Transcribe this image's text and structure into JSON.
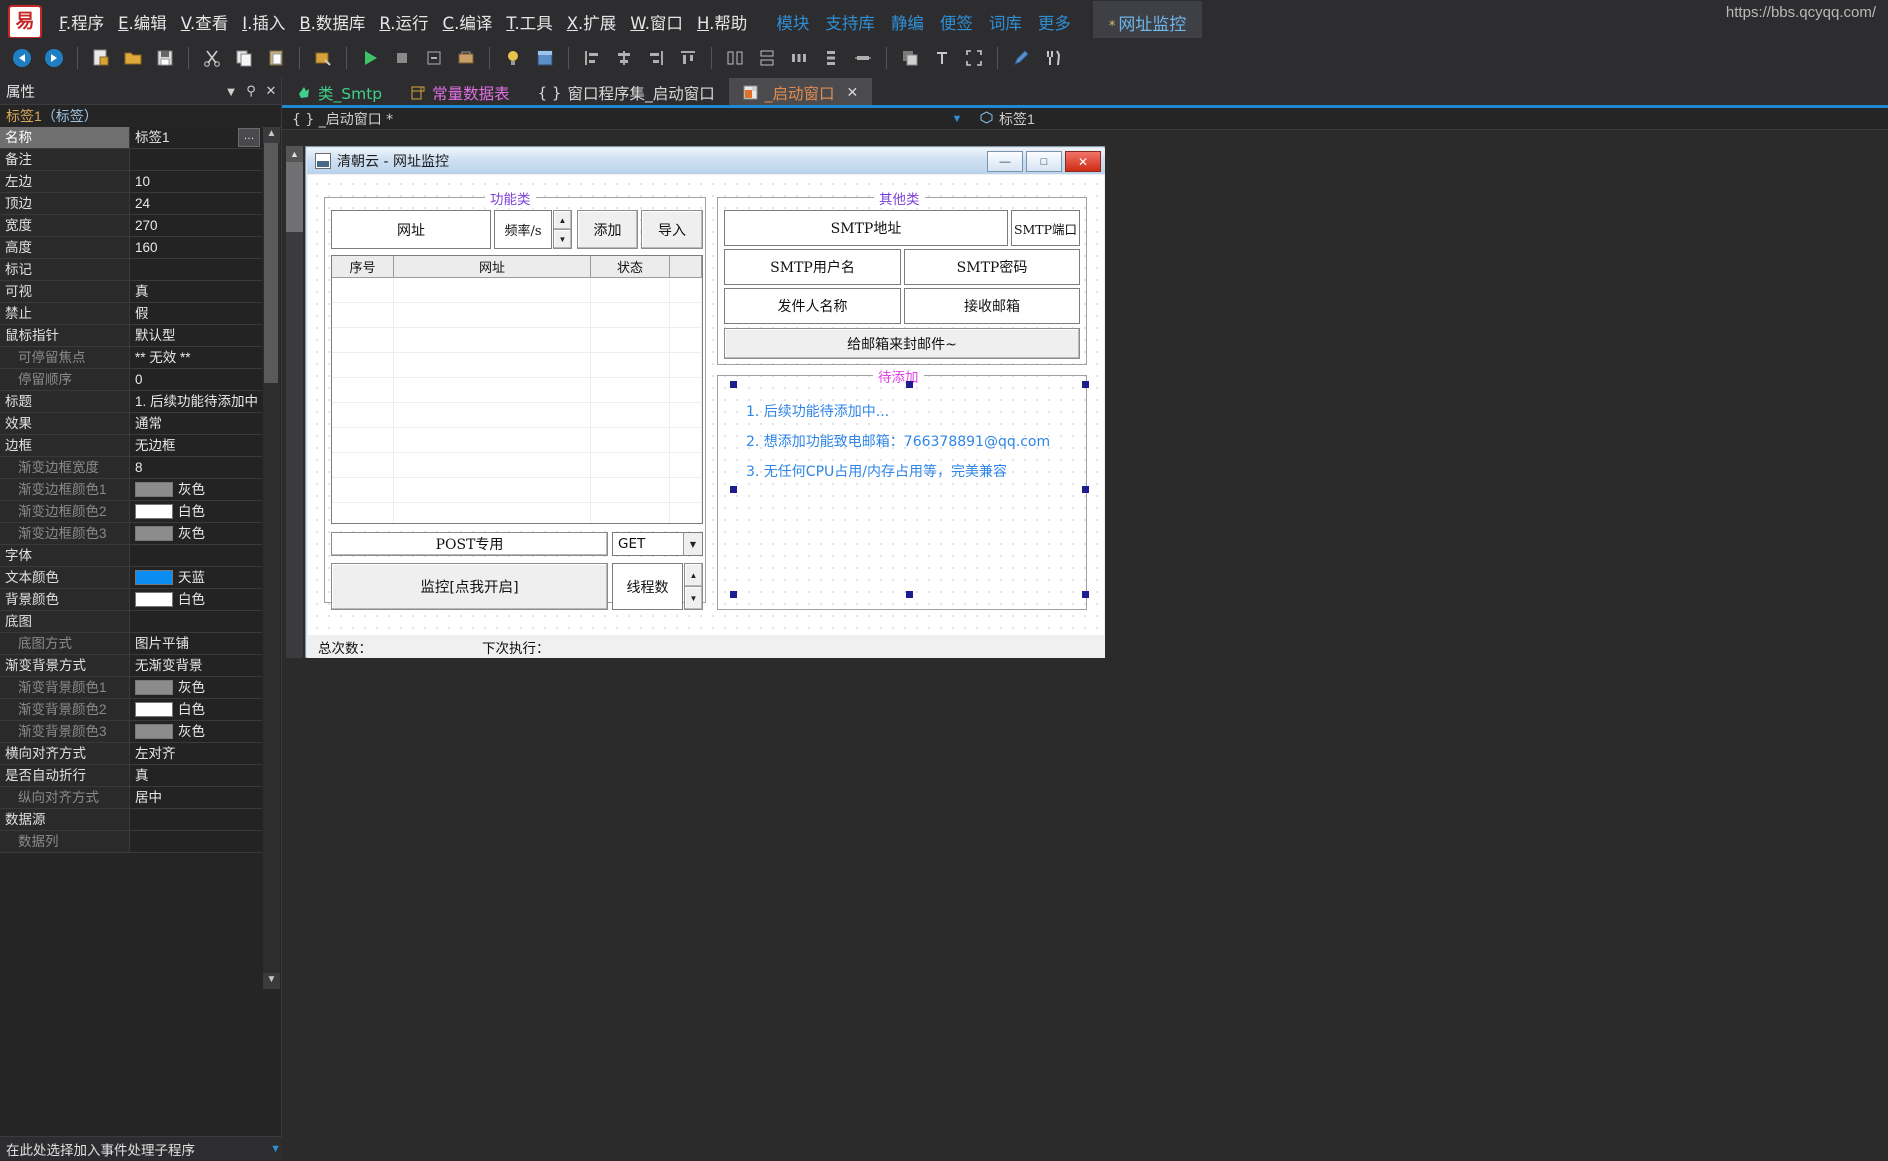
{
  "app": {
    "logo_char": "易",
    "url_right": "https://bbs.qcyqq.com/"
  },
  "menubar": {
    "items": [
      {
        "hotkey": "F",
        "label": ".程序"
      },
      {
        "hotkey": "E",
        "label": ".编辑"
      },
      {
        "hotkey": "V",
        "label": ".查看"
      },
      {
        "hotkey": "I",
        "label": ".插入"
      },
      {
        "hotkey": "B",
        "label": ".数据库"
      },
      {
        "hotkey": "R",
        "label": ".运行"
      },
      {
        "hotkey": "C",
        "label": ".编译"
      },
      {
        "hotkey": "T",
        "label": ".工具"
      },
      {
        "hotkey": "X",
        "label": ".扩展"
      },
      {
        "hotkey": "W",
        "label": ".窗口"
      },
      {
        "hotkey": "H",
        "label": ".帮助"
      }
    ],
    "blue_items": [
      "模块",
      "支持库",
      "静编",
      "便签",
      "词库",
      "更多"
    ],
    "project_tab": {
      "star": "*",
      "label": "网址监控"
    }
  },
  "properties_panel": {
    "title": "属性",
    "object": "标签1（标签）",
    "object_name": "标签1",
    "object_type": "（标签）",
    "footer": "在此处选择加入事件处理子程序",
    "rows": [
      {
        "key": "名称",
        "value": "标签1",
        "dim": false,
        "selected": true,
        "ellipsis": true
      },
      {
        "key": "备注",
        "value": "",
        "dim": false
      },
      {
        "key": "左边",
        "value": "10",
        "dim": false
      },
      {
        "key": "顶边",
        "value": "24",
        "dim": false
      },
      {
        "key": "宽度",
        "value": "270",
        "dim": false
      },
      {
        "key": "高度",
        "value": "160",
        "dim": false
      },
      {
        "key": "标记",
        "value": "",
        "dim": false
      },
      {
        "key": "可视",
        "value": "真",
        "dim": false
      },
      {
        "key": "禁止",
        "value": "假",
        "dim": false
      },
      {
        "key": "鼠标指针",
        "value": "默认型",
        "dim": false
      },
      {
        "key": "可停留焦点",
        "value": "**  无效  **",
        "dim": true
      },
      {
        "key": "停留顺序",
        "value": "0",
        "dim": true
      },
      {
        "key": "标题",
        "value": "1. 后续功能待添加中",
        "dim": false
      },
      {
        "key": "效果",
        "value": "通常",
        "dim": false
      },
      {
        "key": "边框",
        "value": "无边框",
        "dim": false
      },
      {
        "key": "渐变边框宽度",
        "value": "8",
        "dim": true
      },
      {
        "key": "渐变边框颜色1",
        "value": "灰色",
        "dim": true,
        "swatch": "#8c8c8c"
      },
      {
        "key": "渐变边框颜色2",
        "value": "白色",
        "dim": true,
        "swatch": "#ffffff"
      },
      {
        "key": "渐变边框颜色3",
        "value": "灰色",
        "dim": true,
        "swatch": "#8c8c8c"
      },
      {
        "key": "字体",
        "value": "",
        "dim": false
      },
      {
        "key": "文本颜色",
        "value": "天蓝",
        "dim": false,
        "swatch": "#0a8cf0"
      },
      {
        "key": "背景颜色",
        "value": "白色",
        "dim": false,
        "swatch": "#ffffff"
      },
      {
        "key": "底图",
        "value": "",
        "dim": false
      },
      {
        "key": "底图方式",
        "value": "图片平铺",
        "dim": true
      },
      {
        "key": "渐变背景方式",
        "value": "无渐变背景",
        "dim": false
      },
      {
        "key": "渐变背景颜色1",
        "value": "灰色",
        "dim": true,
        "swatch": "#8c8c8c"
      },
      {
        "key": "渐变背景颜色2",
        "value": "白色",
        "dim": true,
        "swatch": "#ffffff"
      },
      {
        "key": "渐变背景颜色3",
        "value": "灰色",
        "dim": true,
        "swatch": "#8c8c8c"
      },
      {
        "key": "横向对齐方式",
        "value": "左对齐",
        "dim": false
      },
      {
        "key": "是否自动折行",
        "value": "真",
        "dim": false
      },
      {
        "key": "纵向对齐方式",
        "value": "居中",
        "dim": true
      },
      {
        "key": "数据源",
        "value": "",
        "dim": false
      },
      {
        "key": "数据列",
        "value": "",
        "dim": true
      }
    ]
  },
  "tabs": [
    {
      "label": "类_Smtp",
      "icon": "class-icon",
      "color": "#3fd18b",
      "active": false
    },
    {
      "label": "常量数据表",
      "icon": "table-icon",
      "color": "#e070e0",
      "active": false
    },
    {
      "label": "窗口程序集_启动窗口",
      "icon": "braces-icon",
      "color": "#d8d8d8",
      "active": false
    },
    {
      "label": "_启动窗口",
      "icon": "window-icon",
      "color": "#e08c50",
      "active": true,
      "closable": true
    }
  ],
  "breadcrumb": {
    "left": "{ } _启动窗口 *",
    "right": "标签1"
  },
  "design_form": {
    "title": "清朝云 - 网址监控",
    "window_buttons": {
      "minimize": "—",
      "maximize": "□",
      "close": "✕"
    },
    "group_left": {
      "legend": "功能类",
      "legend_color": "#7a3fd8",
      "url_input": "网址",
      "freq_input": "频率/s",
      "add_button": "添加",
      "import_button": "导入",
      "list_columns": [
        "序号",
        "网址",
        "状态",
        ""
      ],
      "post_button": "POST专用",
      "method_combo": "GET",
      "monitor_button": "监控[点我开启]",
      "thread_label": "线程数"
    },
    "group_right": {
      "legend": "其他类",
      "legend_color": "#7a3fd8",
      "smtp_addr": "SMTP地址",
      "smtp_port": "SMTP端口",
      "smtp_user": "SMTP用户名",
      "smtp_pass": "SMTP密码",
      "sender_name": "发件人名称",
      "receive_mail": "接收邮箱",
      "send_test_button": "给邮箱来封邮件~"
    },
    "group_pending": {
      "legend": "待添加",
      "legend_color": "#e040e0",
      "lines": [
        "1. 后续功能待添加中...",
        "2. 想添加功能致电邮箱：766378891@qq.com",
        "3. 无任何CPU占用/内存占用等，完美兼容"
      ],
      "text_color": "#2f86e8"
    },
    "status": {
      "total_label": "总次数：",
      "next_label": "下次执行："
    }
  }
}
